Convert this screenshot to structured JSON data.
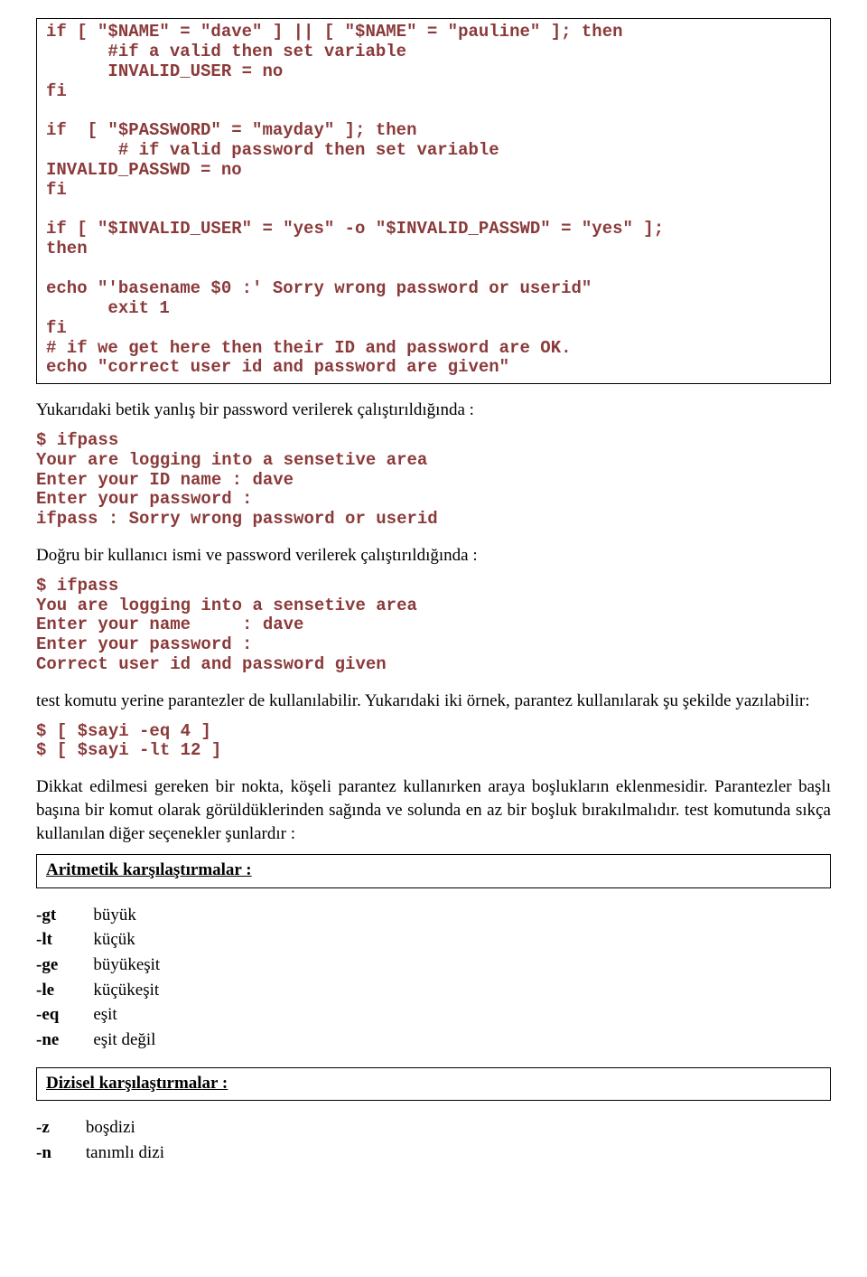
{
  "codeBox1": "if [ \"$NAME\" = \"dave\" ] || [ \"$NAME\" = \"pauline\" ]; then\n      #if a valid then set variable\n      INVALID_USER = no\nfi\n\nif  [ \"$PASSWORD\" = \"mayday\" ]; then\n       # if valid password then set variable\nINVALID_PASSWD = no\nfi\n\nif [ \"$INVALID_USER\" = \"yes\" -o \"$INVALID_PASSWD\" = \"yes\" ];\nthen\n\necho \"'basename $0 :' Sorry wrong password or userid\"\n      exit 1\nfi\n# if we get here then their ID and password are OK.\necho \"correct user id and password are given\"",
  "para1": "Yukarıdaki betik yanlış bir password verilerek çalıştırıldığında :",
  "codeBlk1": "$ ifpass\nYour are logging into a sensetive area\nEnter your ID name : dave\nEnter your password :\nifpass : Sorry wrong password or userid",
  "para2": "Doğru bir kullanıcı ismi ve password verilerek çalıştırıldığında :",
  "codeBlk2": "$ ifpass\nYou are logging into a sensetive area\nEnter your name     : dave\nEnter your password :\nCorrect user id and password given",
  "para3": "test komutu yerine parantezler de kullanılabilir. Yukarıdaki iki örnek, parantez kullanılarak şu şekilde yazılabilir:",
  "codeBlk3": "$ [ $sayi -eq 4 ]\n$ [ $sayi -lt 12 ]",
  "para4": "Dikkat edilmesi gereken bir nokta, köşeli parantez kullanırken araya boşlukların eklenmesidir. Parantezler başlı başına bir komut olarak görüldüklerinden sağında ve solunda en az bir boşluk bırakılmalıdır. test komutunda sıkça kullanılan diğer seçenekler şunlardır :",
  "heading1": "Aritmetik karşılaştırmalar :",
  "aritmetik": [
    {
      "k": "-gt",
      "v": "büyük"
    },
    {
      "k": "-lt",
      "v": "küçük"
    },
    {
      "k": "-ge",
      "v": "büyükeşit"
    },
    {
      "k": "-le",
      "v": "küçükeşit"
    },
    {
      "k": "-eq",
      "v": "eşit"
    },
    {
      "k": "-ne",
      "v": "eşit değil"
    }
  ],
  "heading2": "Dizisel karşılaştırmalar :",
  "dizisel": [
    {
      "k": "-z",
      "v": "boşdizi"
    },
    {
      "k": "-n",
      "v": "tanımlı dizi"
    }
  ]
}
